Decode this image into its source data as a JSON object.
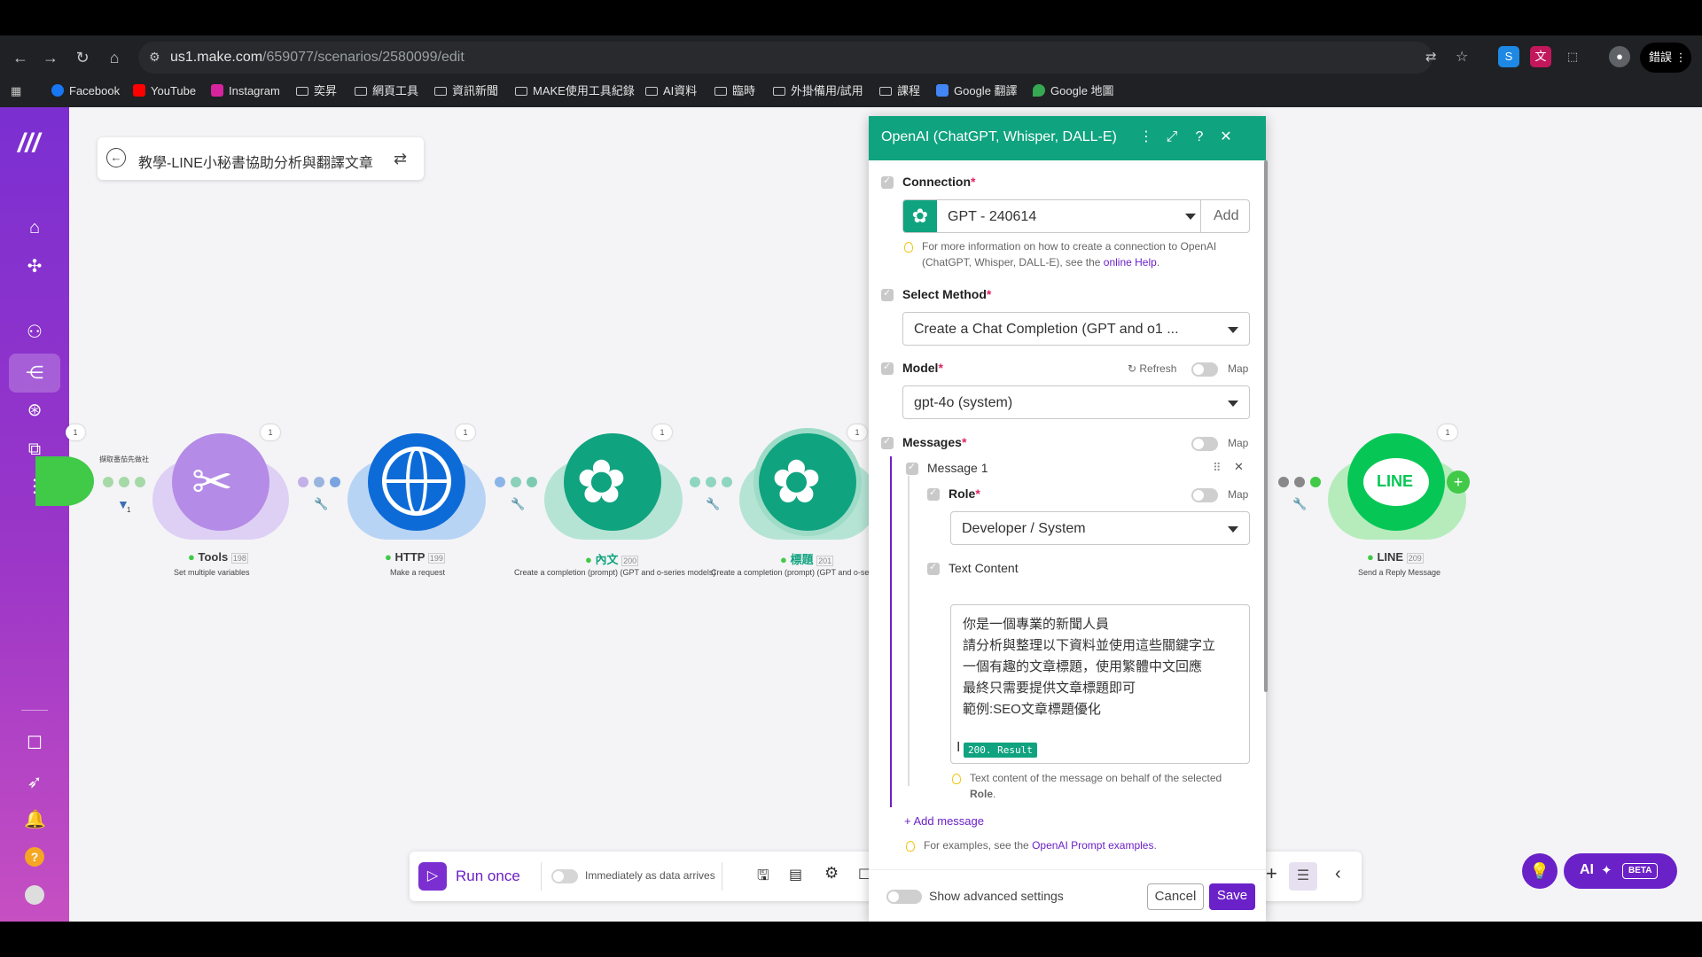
{
  "browser": {
    "url_host": "us1.make.com",
    "url_path": "/659077/scenarios/2580099/edit",
    "profile_label": "錯誤",
    "bookmarks": [
      "Facebook",
      "YouTube",
      "Instagram",
      "奕昇",
      "網頁工具",
      "資訊新聞",
      "MAKE使用工具紀錄",
      "AI資料",
      "臨時",
      "外掛備用/試用",
      "課程",
      "Google 翻譯",
      "Google 地圖"
    ]
  },
  "scenario": {
    "title": "教學-LINE小秘書協助分析與翻譯文章"
  },
  "modules": [
    {
      "name": "Tools",
      "id": "198",
      "sub": "Set multiple variables",
      "badge": "1"
    },
    {
      "name": "HTTP",
      "id": "199",
      "sub": "Make a request",
      "badge": "1"
    },
    {
      "name": "內文",
      "id": "200",
      "sub": "Create a completion (prompt) (GPT and o-series models)",
      "badge": "1"
    },
    {
      "name": "標題",
      "id": "201",
      "sub": "Create a completion (prompt) (GPT and o-se",
      "badge": "1"
    },
    {
      "name": "LINE",
      "id": "209",
      "sub": "Send a Reply Message",
      "badge": "1"
    }
  ],
  "left_partial": {
    "label": "擷取番茄先做社",
    "badge": "1",
    "filter_count": "1"
  },
  "toolbar": {
    "run_once": "Run once",
    "immediately": "Immediately as data arrives"
  },
  "panel": {
    "title": "OpenAI (ChatGPT, Whisper, DALL-E)",
    "connection_label": "Connection",
    "connection_value": "GPT - 240614",
    "add_label": "Add",
    "connection_hint_1": "For more information on how to create a connection to OpenAI",
    "connection_hint_2": "(ChatGPT, Whisper, DALL-E), see the",
    "connection_hint_link": "online Help",
    "method_label": "Select Method",
    "method_value": "Create a Chat Completion (GPT and o1 ...",
    "model_label": "Model",
    "refresh_label": "Refresh",
    "map_label": "Map",
    "model_value": "gpt-4o (system)",
    "messages_label": "Messages",
    "message1_label": "Message 1",
    "role_label": "Role",
    "role_value": "Developer / System",
    "text_content_label": "Text Content",
    "text_lines": [
      "你是一個專業的新聞人員",
      "請分析與整理以下資料並使用這些關鍵字立",
      "一個有趣的文章標題，使用繁體中文回應",
      "最終只需要提供文章標題即可",
      "範例:SEO文章標題優化"
    ],
    "result_pill": "200. Result",
    "text_hint_1": "Text content of the message on behalf of the selected",
    "text_hint_2": "Role",
    "add_message": "Add message",
    "examples_hint": "For examples, see the",
    "examples_link": "OpenAI Prompt examples",
    "advanced": "Show advanced settings",
    "cancel": "Cancel",
    "save": "Save"
  },
  "ai_button": {
    "label": "AI",
    "beta": "BETA"
  },
  "colors": {
    "brand_purple": "#6b21c8",
    "openai_green": "#10a37f",
    "line_green": "#06c755",
    "http_blue": "#0d6bd8",
    "tools_purple": "#b48be6"
  }
}
